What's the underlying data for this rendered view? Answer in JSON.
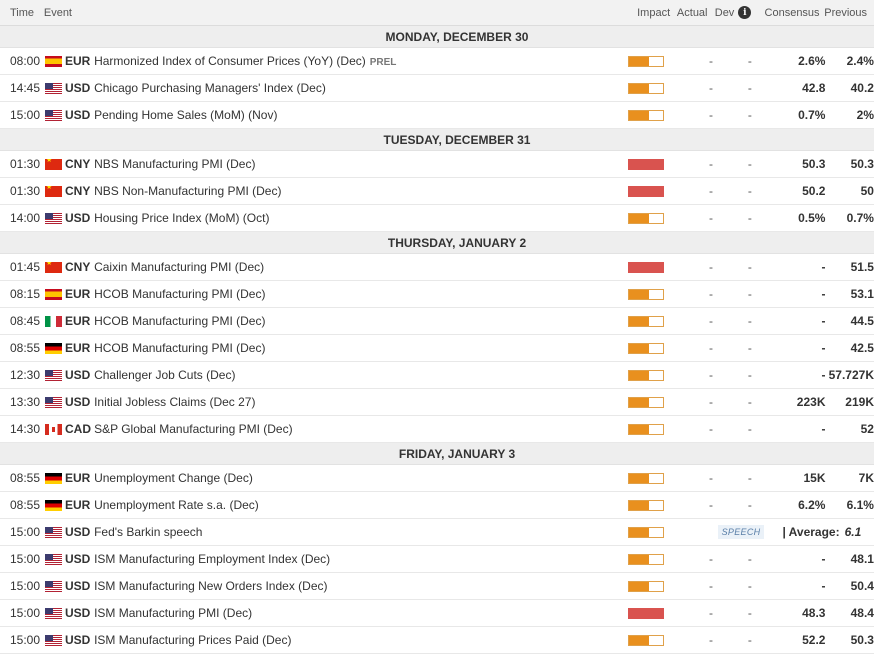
{
  "header": {
    "time": "Time",
    "event": "Event",
    "impact": "Impact",
    "actual": "Actual",
    "dev": "Dev",
    "consensus": "Consensus",
    "previous": "Previous"
  },
  "impact_colors": {
    "medium": "#e9901e",
    "high": "#d9534f"
  },
  "days": [
    {
      "date": "MONDAY, DECEMBER 30",
      "events": [
        {
          "time": "08:00",
          "flag": "es",
          "currency": "EUR",
          "event": "Harmonized Index of Consumer Prices (YoY) (Dec)",
          "tag": "PREL",
          "impact": "medium",
          "actual": "-",
          "dev": "-",
          "consensus": "2.6%",
          "previous": "2.4%"
        },
        {
          "time": "14:45",
          "flag": "us",
          "currency": "USD",
          "event": "Chicago Purchasing Managers' Index (Dec)",
          "impact": "medium",
          "actual": "-",
          "dev": "-",
          "consensus": "42.8",
          "previous": "40.2"
        },
        {
          "time": "15:00",
          "flag": "us",
          "currency": "USD",
          "event": "Pending Home Sales (MoM) (Nov)",
          "impact": "medium",
          "actual": "-",
          "dev": "-",
          "consensus": "0.7%",
          "previous": "2%"
        }
      ]
    },
    {
      "date": "TUESDAY, DECEMBER 31",
      "events": [
        {
          "time": "01:30",
          "flag": "cn",
          "currency": "CNY",
          "event": "NBS Manufacturing PMI (Dec)",
          "impact": "high",
          "actual": "-",
          "dev": "-",
          "consensus": "50.3",
          "previous": "50.3"
        },
        {
          "time": "01:30",
          "flag": "cn",
          "currency": "CNY",
          "event": "NBS Non-Manufacturing PMI (Dec)",
          "impact": "high",
          "actual": "-",
          "dev": "-",
          "consensus": "50.2",
          "previous": "50"
        },
        {
          "time": "14:00",
          "flag": "us",
          "currency": "USD",
          "event": "Housing Price Index (MoM) (Oct)",
          "impact": "medium",
          "actual": "-",
          "dev": "-",
          "consensus": "0.5%",
          "previous": "0.7%"
        }
      ]
    },
    {
      "date": "THURSDAY, JANUARY 2",
      "events": [
        {
          "time": "01:45",
          "flag": "cn",
          "currency": "CNY",
          "event": "Caixin Manufacturing PMI (Dec)",
          "impact": "high",
          "actual": "-",
          "dev": "-",
          "consensus": "-",
          "previous": "51.5"
        },
        {
          "time": "08:15",
          "flag": "es",
          "currency": "EUR",
          "event": "HCOB Manufacturing PMI (Dec)",
          "impact": "medium",
          "actual": "-",
          "dev": "-",
          "consensus": "-",
          "previous": "53.1"
        },
        {
          "time": "08:45",
          "flag": "it",
          "currency": "EUR",
          "event": "HCOB Manufacturing PMI (Dec)",
          "impact": "medium",
          "actual": "-",
          "dev": "-",
          "consensus": "-",
          "previous": "44.5"
        },
        {
          "time": "08:55",
          "flag": "de",
          "currency": "EUR",
          "event": "HCOB Manufacturing PMI (Dec)",
          "impact": "medium",
          "actual": "-",
          "dev": "-",
          "consensus": "-",
          "previous": "42.5"
        },
        {
          "time": "12:30",
          "flag": "us",
          "currency": "USD",
          "event": "Challenger Job Cuts (Dec)",
          "impact": "medium",
          "actual": "-",
          "dev": "-",
          "consensus": "-",
          "previous": "57.727K"
        },
        {
          "time": "13:30",
          "flag": "us",
          "currency": "USD",
          "event": "Initial Jobless Claims (Dec 27)",
          "impact": "medium",
          "actual": "-",
          "dev": "-",
          "consensus": "223K",
          "previous": "219K"
        },
        {
          "time": "14:30",
          "flag": "ca",
          "currency": "CAD",
          "event": "S&P Global Manufacturing PMI (Dec)",
          "impact": "medium",
          "actual": "-",
          "dev": "-",
          "consensus": "-",
          "previous": "52"
        }
      ]
    },
    {
      "date": "FRIDAY, JANUARY 3",
      "events": [
        {
          "time": "08:55",
          "flag": "de",
          "currency": "EUR",
          "event": "Unemployment Change (Dec)",
          "impact": "medium",
          "actual": "-",
          "dev": "-",
          "consensus": "15K",
          "previous": "7K"
        },
        {
          "time": "08:55",
          "flag": "de",
          "currency": "EUR",
          "event": "Unemployment Rate s.a. (Dec)",
          "impact": "medium",
          "actual": "-",
          "dev": "-",
          "consensus": "6.2%",
          "previous": "6.1%"
        },
        {
          "time": "15:00",
          "flag": "us",
          "currency": "USD",
          "event": "Fed's Barkin speech",
          "impact": "medium",
          "speech": true,
          "speech_label": "SPEECH",
          "average_label": "|  Average:",
          "average_value": "6.1"
        },
        {
          "time": "15:00",
          "flag": "us",
          "currency": "USD",
          "event": "ISM Manufacturing Employment Index (Dec)",
          "impact": "medium",
          "actual": "-",
          "dev": "-",
          "consensus": "-",
          "previous": "48.1"
        },
        {
          "time": "15:00",
          "flag": "us",
          "currency": "USD",
          "event": "ISM Manufacturing New Orders Index (Dec)",
          "impact": "medium",
          "actual": "-",
          "dev": "-",
          "consensus": "-",
          "previous": "50.4"
        },
        {
          "time": "15:00",
          "flag": "us",
          "currency": "USD",
          "event": "ISM Manufacturing PMI (Dec)",
          "impact": "high",
          "actual": "-",
          "dev": "-",
          "consensus": "48.3",
          "previous": "48.4"
        },
        {
          "time": "15:00",
          "flag": "us",
          "currency": "USD",
          "event": "ISM Manufacturing Prices Paid (Dec)",
          "impact": "medium",
          "actual": "-",
          "dev": "-",
          "consensus": "52.2",
          "previous": "50.3"
        }
      ]
    }
  ]
}
